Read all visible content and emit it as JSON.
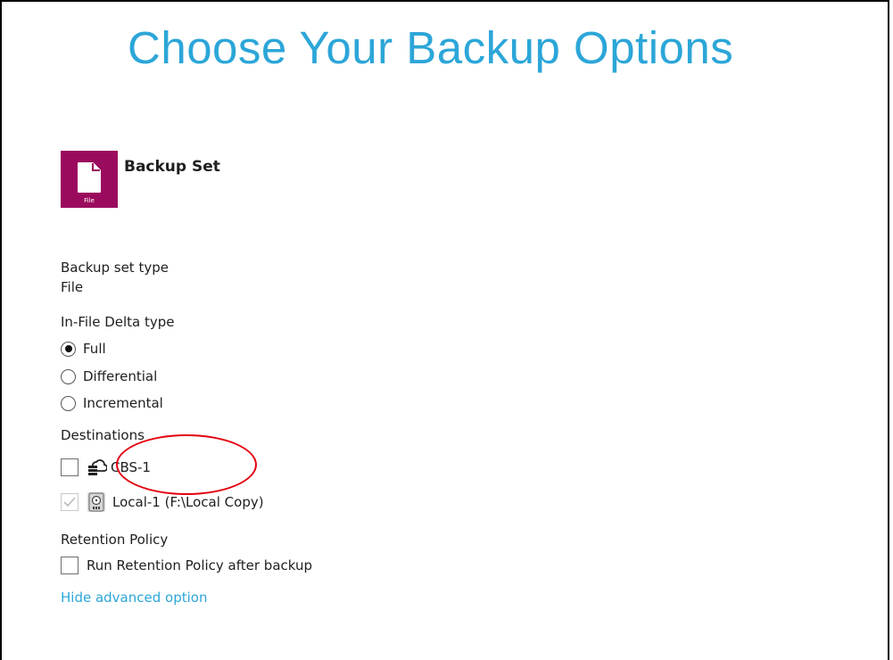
{
  "page": {
    "title": "Choose Your Backup Options"
  },
  "backup_set": {
    "icon_caption": "File",
    "heading": "Backup Set",
    "icon_color": "#9b0b5d"
  },
  "set_type": {
    "label": "Backup set type",
    "value": "File"
  },
  "delta": {
    "label": "In-File Delta type",
    "options": [
      {
        "label": "Full",
        "selected": true
      },
      {
        "label": "Differential",
        "selected": false
      },
      {
        "label": "Incremental",
        "selected": false
      }
    ]
  },
  "destinations": {
    "label": "Destinations",
    "items": [
      {
        "label": "CBS-1",
        "checked": false,
        "icon": "cloud-server-icon"
      },
      {
        "label": "Local-1 (F:\\Local Copy)",
        "checked": true,
        "disabled": true,
        "icon": "local-drive-icon"
      }
    ]
  },
  "retention": {
    "label": "Retention Policy",
    "checkbox_label": "Run Retention Policy after backup",
    "checked": false
  },
  "advanced": {
    "link_label": "Hide advanced option"
  },
  "colors": {
    "accent": "#2ca6d8",
    "annotation": "#e3000f"
  }
}
